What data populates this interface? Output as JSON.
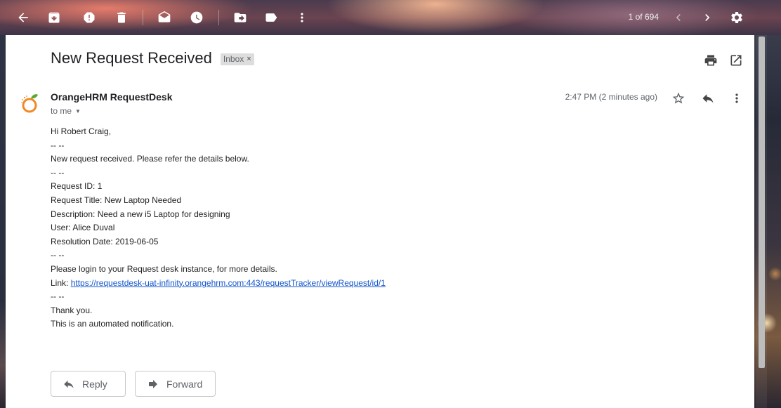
{
  "toolbar": {
    "counter": "1 of 694",
    "buttons": [
      {
        "name": "back-button",
        "icon": "arrow-left-icon"
      },
      {
        "name": "archive-button",
        "icon": "archive-icon"
      },
      {
        "name": "report-spam-button",
        "icon": "spam-icon"
      },
      {
        "name": "delete-button",
        "icon": "trash-icon"
      },
      {
        "name": "mark-unread-button",
        "icon": "mark-unread-icon"
      },
      {
        "name": "snooze-button",
        "icon": "clock-icon"
      },
      {
        "name": "move-to-button",
        "icon": "move-to-folder-icon"
      },
      {
        "name": "labels-button",
        "icon": "label-icon"
      },
      {
        "name": "more-button",
        "icon": "more-vert-icon"
      },
      {
        "name": "newer-button",
        "icon": "chevron-left-icon"
      },
      {
        "name": "older-button",
        "icon": "chevron-right-icon"
      },
      {
        "name": "settings-button",
        "icon": "gear-icon"
      }
    ]
  },
  "email": {
    "subject": "New Request Received",
    "label": "Inbox",
    "label_remove": "×",
    "sender": "OrangeHRM RequestDesk",
    "recipient": "to me",
    "timestamp": "2:47 PM (2 minutes ago)",
    "body": {
      "greeting": "Hi Robert Craig,",
      "sep1": "-- --",
      "intro": "New request received. Please refer the details below.",
      "sep2": "-- --",
      "request_id": "Request ID: 1",
      "request_title": "Request Title: New Laptop Needed",
      "description": "Description: Need a new i5 Laptop for designing",
      "user": "User: Alice Duval",
      "resolution_date": "Resolution Date: 2019-06-05",
      "sep3": "-- --",
      "login_note": "Please login to your Request desk instance, for more details.",
      "link_label": "Link: ",
      "link_url": "https://requestdesk-uat-infinity.orangehrm.com:443/requestTracker/viewRequest/id/1",
      "sep4": "-- --",
      "thanks": "Thank you.",
      "automated": "This is an automated notification."
    }
  },
  "actions": {
    "reply_label": "Reply",
    "forward_label": "Forward"
  },
  "colors": {
    "link": "#1155cc",
    "orange_logo": "#f08a24",
    "green_leaf": "#5aa832"
  }
}
